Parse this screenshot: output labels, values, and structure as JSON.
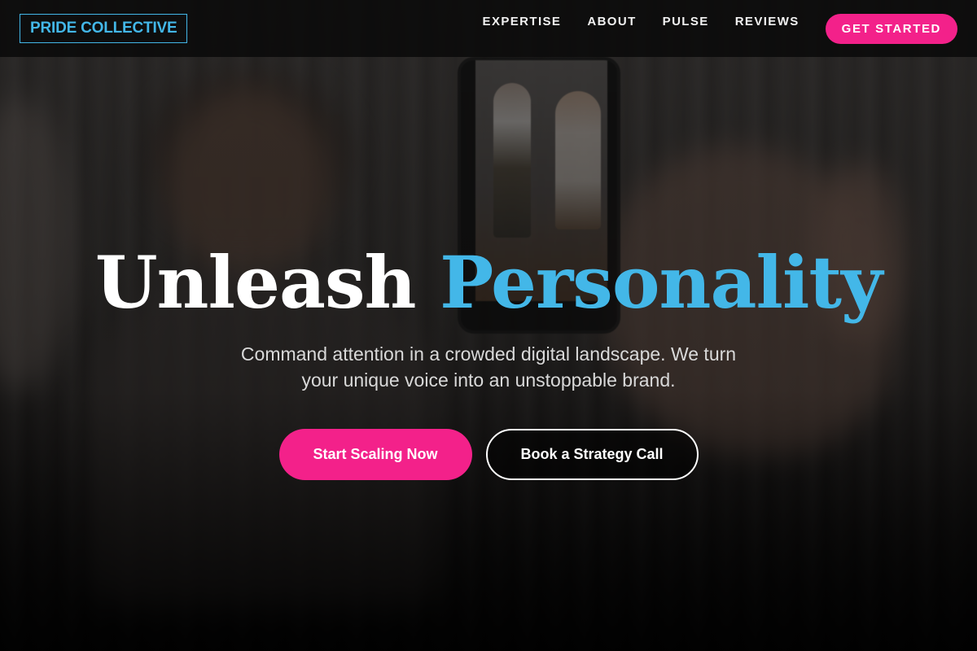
{
  "header": {
    "logo": "PRIDE COLLECTIVE",
    "nav": [
      "EXPERTISE",
      "ABOUT",
      "PULSE",
      "REVIEWS"
    ],
    "cta": "GET STARTED"
  },
  "hero": {
    "headline_part1": "Unleash",
    "headline_part2": "Personality",
    "subtext": "Command attention in a crowded digital landscape. We turn your unique voice into an unstoppable brand.",
    "primary_button": "Start Scaling Now",
    "secondary_button": "Book a Strategy Call"
  },
  "colors": {
    "accent_pink": "#f3218a",
    "accent_blue": "#43b7e8",
    "background": "#0b0b0b"
  }
}
